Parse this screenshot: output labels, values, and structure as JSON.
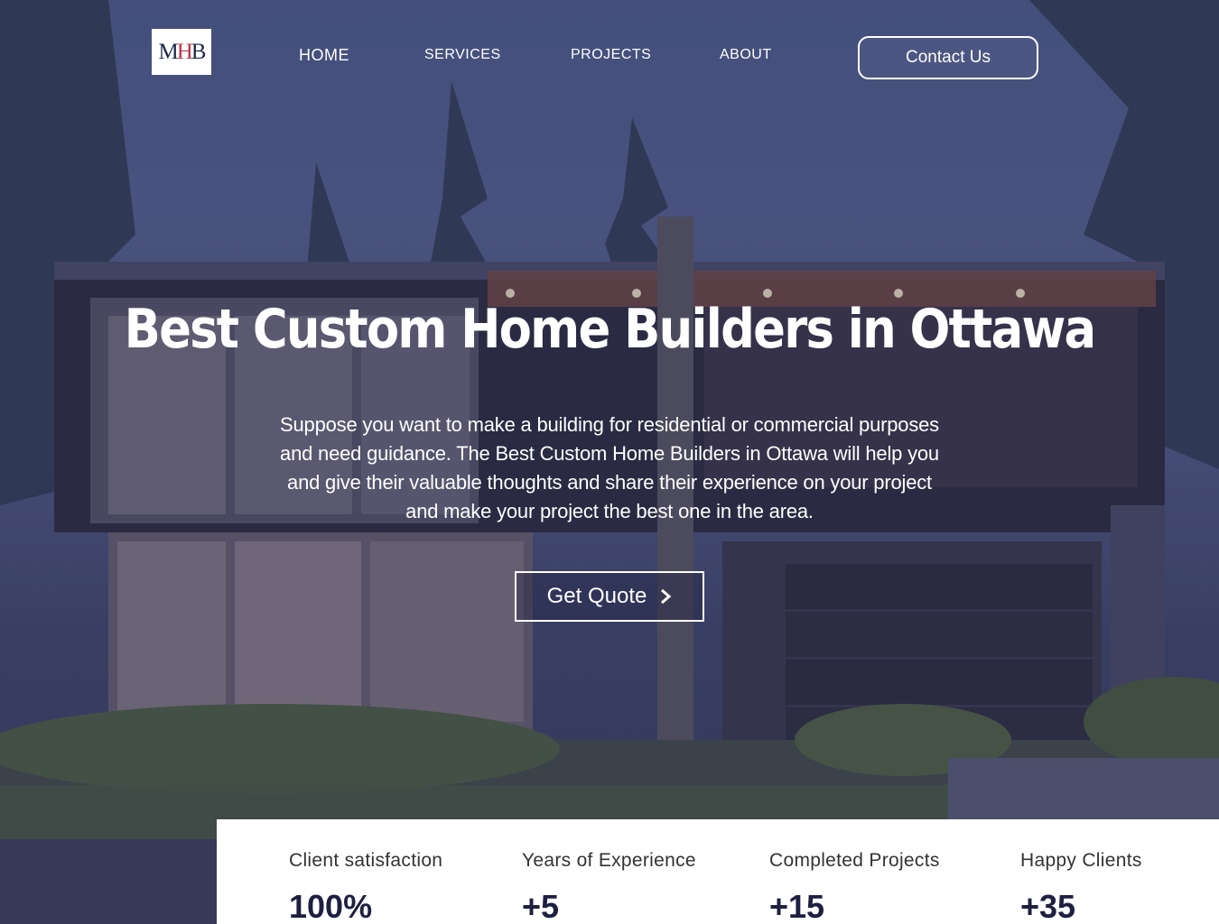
{
  "brand": {
    "logo_text_m": "M",
    "logo_text_h": "H",
    "logo_text_b": "B"
  },
  "nav": {
    "items": [
      "HOME",
      "SERVICES",
      "PROJECTS",
      "ABOUT"
    ],
    "contact_label": "Contact Us"
  },
  "hero": {
    "title": "Best Custom Home Builders in Ottawa",
    "description": "Suppose you want to make a building for residential or commercial purposes and need guidance. The Best Custom Home Builders in Ottawa will help you and give their valuable thoughts and share their experience on your project and make your project the best one in the area.",
    "cta_label": "Get Quote"
  },
  "stats": [
    {
      "label": "Client satisfaction",
      "value": "100%"
    },
    {
      "label": "Years of Experience",
      "value": "+5"
    },
    {
      "label": "Completed Projects",
      "value": "+15"
    },
    {
      "label": "Happy Clients",
      "value": "+35"
    }
  ],
  "colors": {
    "overlay": "#282e5a",
    "logo_accent": "#c0354a",
    "stat_value": "#1d2040",
    "stats_panel": "#ffffff"
  },
  "icons": {
    "cta_icon": "chevron-right-icon"
  }
}
